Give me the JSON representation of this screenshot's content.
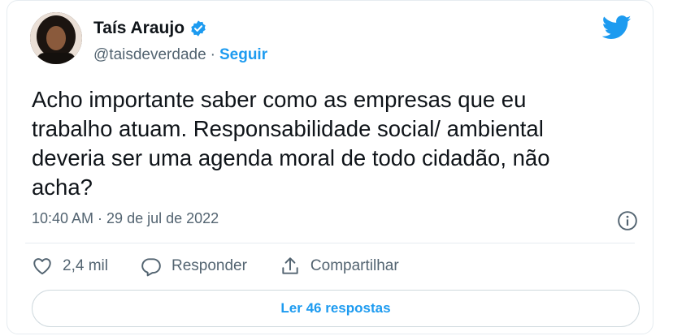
{
  "author": {
    "display_name": "Taís Araujo",
    "handle": "@taisdeverdade",
    "separator": "·",
    "follow_label": "Seguir"
  },
  "tweet": {
    "text": "Acho importante saber como as empresas que eu trabalho atuam. Responsabilidade social/ ambiental deveria ser uma agenda moral de todo cidadão, não acha?",
    "timestamp": "10:40 AM · 29 de jul de 2022"
  },
  "actions": {
    "like_count": "2,4 mil",
    "reply_label": "Responder",
    "share_label": "Compartilhar"
  },
  "replies_button": "Ler 46 respostas",
  "colors": {
    "accent": "#1d9bf0",
    "text_primary": "#0f1419",
    "text_secondary": "#536471",
    "border": "#cfd9de"
  },
  "icons": [
    "avatar",
    "verified-badge-icon",
    "twitter-bird-icon",
    "info-icon",
    "heart-icon",
    "reply-icon",
    "share-icon"
  ]
}
